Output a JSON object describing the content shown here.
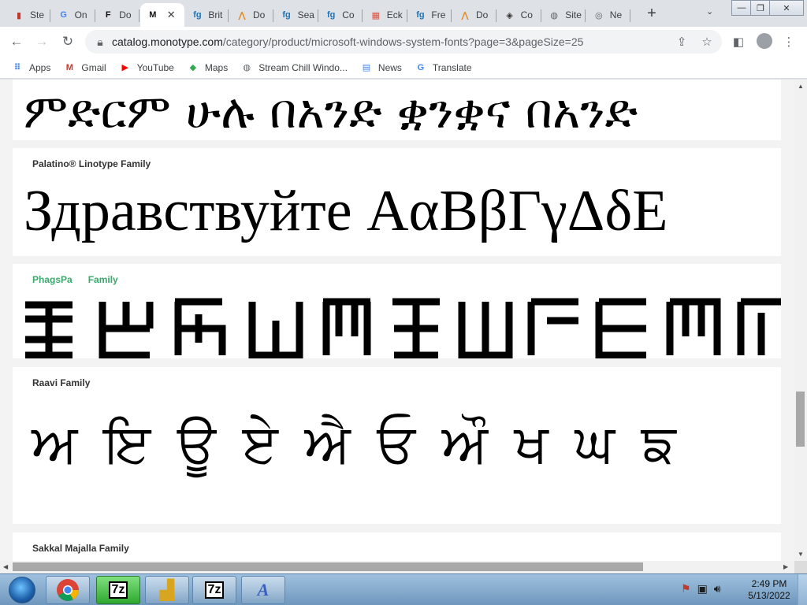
{
  "tabs": [
    {
      "title": "Ste",
      "favicon": "red-bars",
      "color": "#c0392b",
      "glyph": "▮"
    },
    {
      "title": "On",
      "favicon": "google",
      "color": "#4285f4",
      "glyph": "G"
    },
    {
      "title": "Do",
      "favicon": "f-logo",
      "color": "#111111",
      "glyph": "F"
    },
    {
      "title": "",
      "favicon": "m-logo",
      "color": "#111111",
      "glyph": "M",
      "active": true,
      "close": "✕"
    },
    {
      "title": "Brit",
      "favicon": "fg",
      "color": "#1a73b8",
      "glyph": "fg"
    },
    {
      "title": "Do",
      "favicon": "orange-a",
      "color": "#e8891d",
      "glyph": "⋀"
    },
    {
      "title": "Sea",
      "favicon": "fg",
      "color": "#1a73b8",
      "glyph": "fg"
    },
    {
      "title": "Co",
      "favicon": "fg",
      "color": "#1a73b8",
      "glyph": "fg"
    },
    {
      "title": "Eck",
      "favicon": "windows",
      "color": "#e74c3c",
      "glyph": "▦"
    },
    {
      "title": "Fre",
      "favicon": "fg",
      "color": "#1a73b8",
      "glyph": "fg"
    },
    {
      "title": "Do",
      "favicon": "orange-a",
      "color": "#e8891d",
      "glyph": "⋀"
    },
    {
      "title": "Co",
      "favicon": "shield",
      "color": "#333333",
      "glyph": "◈"
    },
    {
      "title": "Site",
      "favicon": "globe",
      "color": "#5f6368",
      "glyph": "◍"
    },
    {
      "title": "Ne",
      "favicon": "chrome",
      "color": "#5f6368",
      "glyph": "◎"
    }
  ],
  "address": {
    "host": "catalog.monotype.com",
    "path": "/category/product/microsoft-windows-system-fonts?page=3&pageSize=25"
  },
  "bookmarks": [
    {
      "label": "Apps",
      "icon": "apps-grid-icon",
      "glyph": "⠿",
      "color": "#4285f4"
    },
    {
      "label": "Gmail",
      "icon": "gmail-icon",
      "glyph": "M",
      "color": "#d93025"
    },
    {
      "label": "YouTube",
      "icon": "youtube-icon",
      "glyph": "▶",
      "color": "#ff0000"
    },
    {
      "label": "Maps",
      "icon": "maps-icon",
      "glyph": "◆",
      "color": "#34a853"
    },
    {
      "label": "Stream Chill Windo...",
      "icon": "globe-icon",
      "glyph": "◍",
      "color": "#5f6368"
    },
    {
      "label": "News",
      "icon": "news-icon",
      "glyph": "▤",
      "color": "#4285f4"
    },
    {
      "label": "Translate",
      "icon": "translate-icon",
      "glyph": "G",
      "color": "#4285f4"
    }
  ],
  "fonts": [
    {
      "family": "",
      "sample": "ምድርም ሁሉ በአንድ ቋንቋና በአንድ"
    },
    {
      "family": "Palatino® Linotype Family",
      "sample": "Здравствуйте AαBβΓγΔδE"
    },
    {
      "family": "PhagsPa Family",
      "family_visible": "PhagsPa",
      "family_rest": "Family",
      "sample": "ꡀꡁꡂꡃꡄꡅꡆꡇꡈꡉꡊ"
    },
    {
      "family": "Raavi Family",
      "sample": "ਅ ਇ ਊ ਏ ਐ ਓ ਔ ਖ ਘ ਙ"
    },
    {
      "family": "Sakkal Majalla Family",
      "sample": ""
    }
  ],
  "taskbar": {
    "apps": [
      "chrome",
      "7z",
      "folder",
      "7z",
      "font-viewer"
    ],
    "app_labels": {
      "sevenzip": "7z"
    },
    "clock_time": "2:49 PM",
    "clock_date": "5/13/2022"
  }
}
